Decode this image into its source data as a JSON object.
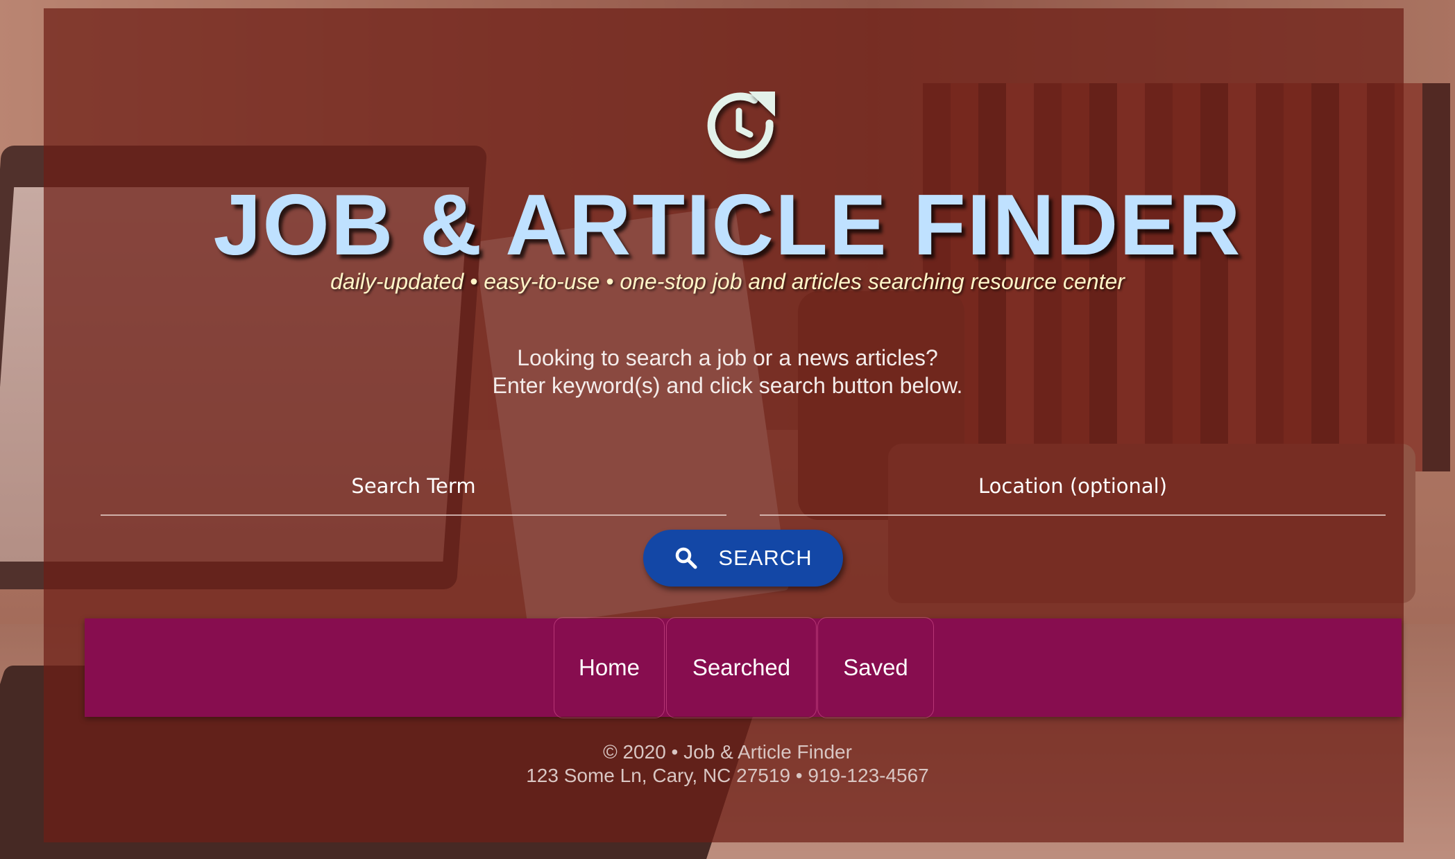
{
  "header": {
    "logo_icon": "clock-refresh-icon",
    "title": "JOB & ARTICLE FINDER",
    "tagline": "daily-updated • easy-to-use • one-stop job and articles searching resource center"
  },
  "intro": {
    "line1": "Looking to search a job or a news articles?",
    "line2": "Enter keyword(s) and click search button below."
  },
  "search_form": {
    "search_term_placeholder": "Search Term",
    "search_term_value": "",
    "location_placeholder": "Location (optional)",
    "location_value": "",
    "button_icon": "search-icon",
    "button_label": "SEARCH"
  },
  "nav": {
    "items": [
      {
        "label": "Home"
      },
      {
        "label": "Searched"
      },
      {
        "label": "Saved"
      }
    ]
  },
  "footer": {
    "line1": "© 2020 • Job & Article Finder",
    "line2": "123 Some Ln, Cary, NC 27519 • 919-123-4567"
  },
  "colors": {
    "title": "#bfe1ff",
    "tagline": "#fff4c7",
    "overlay": "#6e1e16",
    "search_button": "#1347a6",
    "navbar": "#870d4f"
  }
}
